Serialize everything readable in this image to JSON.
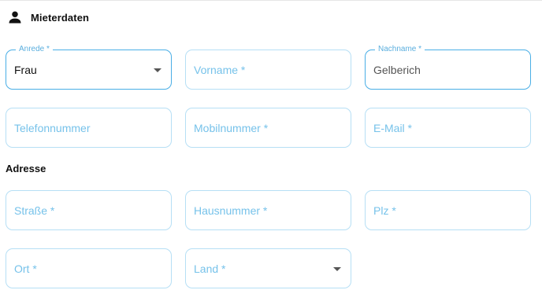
{
  "section": {
    "title": "Mieterdaten",
    "icon": "person-icon"
  },
  "fields_row1": {
    "anrede": {
      "label": "Anrede *",
      "value": "Frau"
    },
    "vorname": {
      "placeholder": "Vorname *"
    },
    "nachname": {
      "label": "Nachname *",
      "value": "Gelberich"
    }
  },
  "fields_row2": {
    "telefon": {
      "placeholder": "Telefonnummer"
    },
    "mobil": {
      "placeholder": "Mobilnummer *"
    },
    "email": {
      "placeholder": "E-Mail *"
    }
  },
  "address": {
    "title": "Adresse",
    "strasse": {
      "placeholder": "Straße *"
    },
    "hausnummer": {
      "placeholder": "Hausnummer *"
    },
    "plz": {
      "placeholder": "Plz *"
    },
    "ort": {
      "placeholder": "Ort *"
    },
    "land": {
      "placeholder": "Land *"
    }
  },
  "colors": {
    "accent": "#49aee6",
    "border": "#b6dff5",
    "placeholder": "#76c2ea"
  }
}
